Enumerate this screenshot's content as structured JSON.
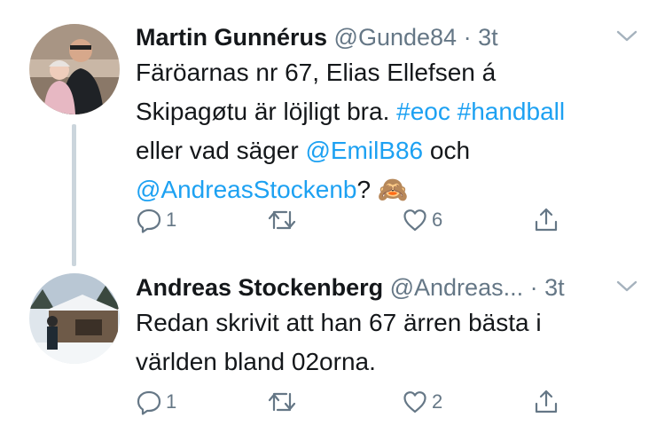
{
  "tweets": [
    {
      "author_name": "Martin Gunnérus",
      "handle": "@Gunde84",
      "separator": "·",
      "time": "3t",
      "text_parts": {
        "p1": "Färöarnas nr 67, Elias Ellefsen á",
        "p2": "Skipagøtu är löjligt bra. ",
        "h1": "#eoc",
        "sp1": " ",
        "h2": "#handball",
        "p3": "eller vad säger ",
        "m1": "@EmilB86",
        "p4": " och",
        "m2": "@AndreasStockenb",
        "p5": "? ",
        "emoji": "🙈"
      },
      "reply_count": "1",
      "like_count": "6"
    },
    {
      "author_name": "Andreas Stockenberg",
      "handle": "@Andreas...",
      "separator": "·",
      "time": "3t",
      "text_lines": [
        "Redan skrivit att han 67 ärren bästa i",
        "världen bland 02orna."
      ],
      "reply_count": "1",
      "like_count": "2"
    }
  ],
  "icons": {
    "caret": "chevron-down-icon",
    "reply": "reply-icon",
    "retweet": "retweet-icon",
    "like": "heart-icon",
    "share": "share-icon"
  },
  "colors": {
    "link": "#1da1f2",
    "secondary": "#657786",
    "thread_line": "#cbd5dc"
  }
}
